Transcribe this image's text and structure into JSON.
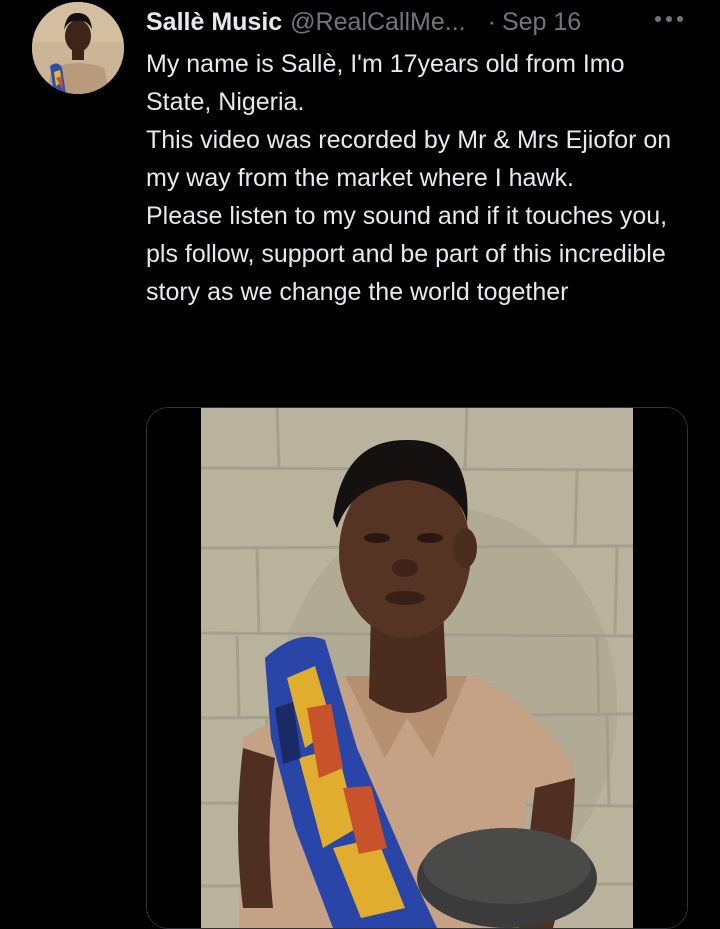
{
  "tweet": {
    "author": {
      "display_name": "Sallè Music",
      "handle": "@RealCallMe...",
      "avatar_icon": "profile-photo-girl"
    },
    "separator": "·",
    "date": "Sep 16",
    "more_icon": "more-horizontal-icon",
    "lines": [
      "My name is Sallè, I'm 17years old from Imo State, Nigeria.",
      "This video was recorded by Mr & Mrs Ejiofor on my way from the market where I hawk.",
      "Please listen to my sound and if it touches you, pls follow, support and be part of this incredible story as we change the world together"
    ],
    "media": {
      "type": "video",
      "icon": "video-thumbnail-girl-with-wrapper"
    }
  },
  "colors": {
    "background": "#000000",
    "text": "#e7e9ea",
    "secondary_text": "#71767b",
    "border": "#2f3336"
  }
}
